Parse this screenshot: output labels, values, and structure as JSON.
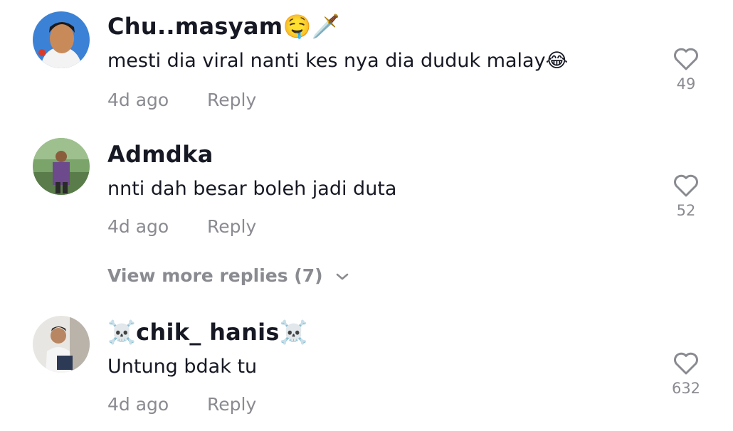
{
  "comments": [
    {
      "username": "Chu..masyam",
      "username_suffix": "🤤🗡️",
      "text": "mesti dia viral nanti kes nya dia duduk malay😂",
      "time": "4d ago",
      "reply_label": "Reply",
      "likes": "49"
    },
    {
      "username": "Admdka",
      "username_suffix": "",
      "text": "nnti dah besar boleh jadi duta",
      "time": "4d ago",
      "reply_label": "Reply",
      "likes": "52"
    },
    {
      "username_prefix": "☠️",
      "username": "chik_ hanis",
      "username_suffix": "☠️",
      "text": "Untung bdak tu",
      "time": "4d ago",
      "reply_label": "Reply",
      "likes": "632"
    }
  ],
  "view_more": {
    "label": "View more replies (7)",
    "icon": "chevron-down-icon"
  },
  "colors": {
    "username": "#161823",
    "text": "#161823",
    "meta": "#8a8b91"
  }
}
